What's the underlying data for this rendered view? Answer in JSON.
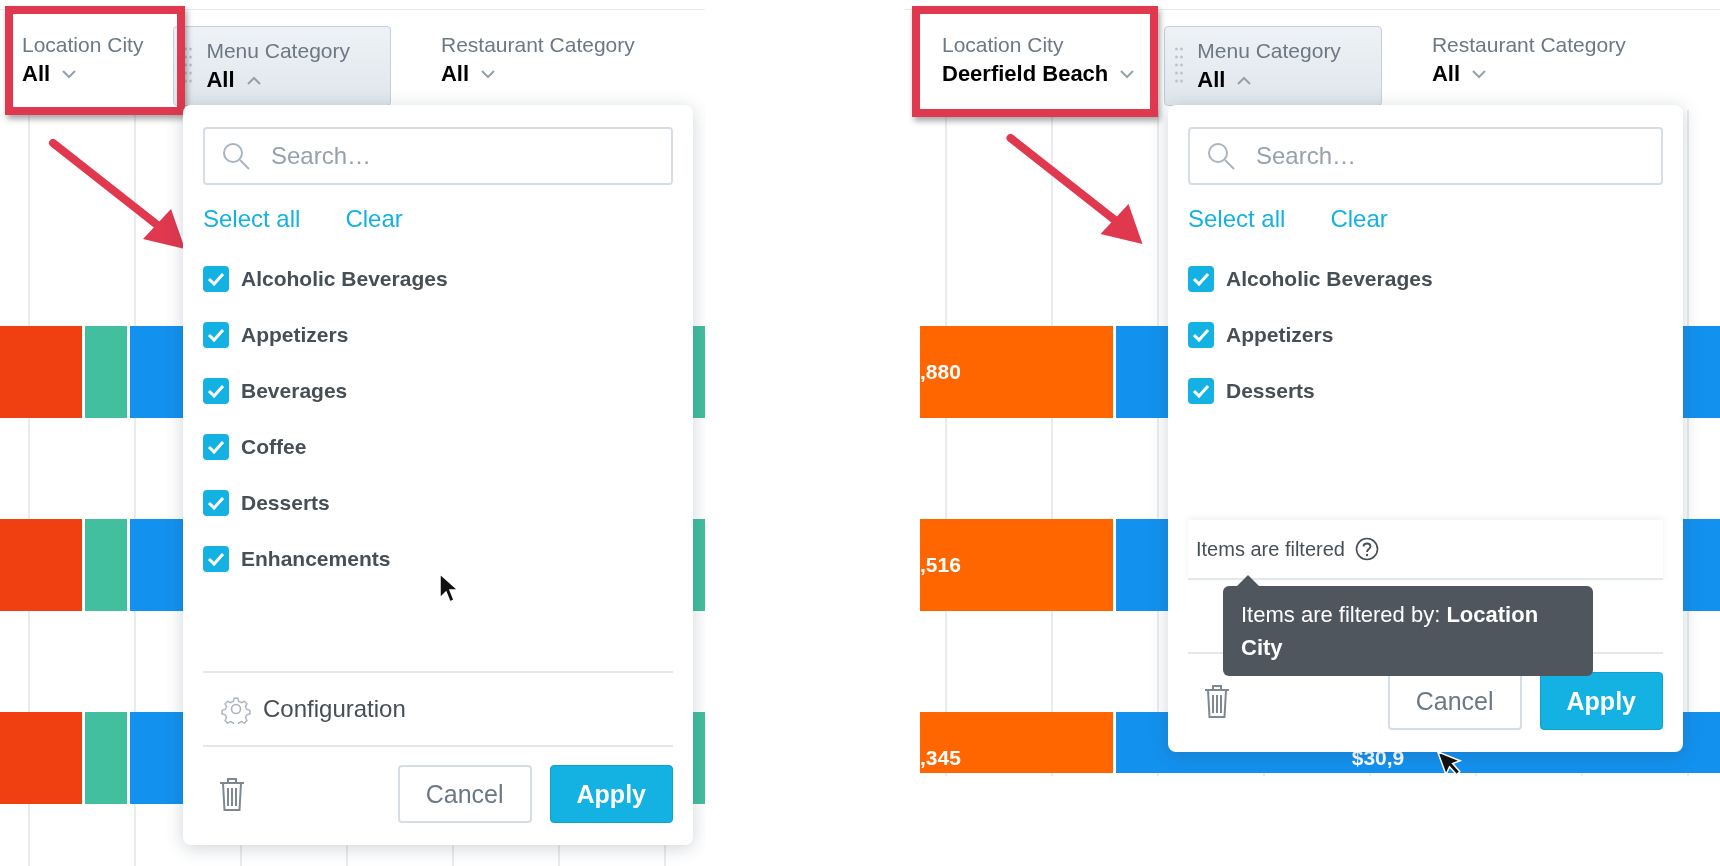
{
  "panels": [
    {
      "filters": [
        {
          "label": "Location City",
          "value": "All",
          "expanded": false,
          "highlighted": true
        },
        {
          "label": "Menu Category",
          "value": "All",
          "expanded": true,
          "highlighted": false
        },
        {
          "label": "Restaurant Category",
          "value": "All",
          "expanded": false,
          "highlighted": false
        }
      ],
      "dropdown": {
        "search": {
          "placeholder": "Search…"
        },
        "select_all": "Select all",
        "clear": "Clear",
        "items": [
          {
            "label": "Alcoholic Beverages",
            "checked": true
          },
          {
            "label": "Appetizers",
            "checked": true
          },
          {
            "label": "Beverages",
            "checked": true
          },
          {
            "label": "Coffee",
            "checked": true
          },
          {
            "label": "Desserts",
            "checked": true
          },
          {
            "label": "Enhancements",
            "checked": true
          }
        ],
        "configuration": "Configuration",
        "cancel": "Cancel",
        "apply": "Apply"
      },
      "chart": {
        "rows": [
          {
            "segments": [
              {
                "color": "#f03f10"
              },
              {
                "color": "#42bf9e"
              },
              {
                "color": "#1391ee"
              },
              {
                "color": "#42bf9e"
              }
            ]
          },
          {
            "segments": [
              {
                "color": "#f03f10"
              },
              {
                "color": "#42bf9e"
              },
              {
                "color": "#1391ee"
              },
              {
                "color": "#42bf9e"
              }
            ]
          },
          {
            "segments": [
              {
                "color": "#f03f10"
              },
              {
                "color": "#42bf9e"
              },
              {
                "color": "#1391ee"
              },
              {
                "color": "#42bf9e"
              }
            ]
          }
        ]
      }
    },
    {
      "filters": [
        {
          "label": "Location City",
          "value": "Deerfield Beach",
          "expanded": false,
          "highlighted": true
        },
        {
          "label": "Menu Category",
          "value": "All",
          "expanded": true,
          "highlighted": false
        },
        {
          "label": "Restaurant Category",
          "value": "All",
          "expanded": false,
          "highlighted": false
        }
      ],
      "dropdown": {
        "search": {
          "placeholder": "Search…"
        },
        "select_all": "Select all",
        "clear": "Clear",
        "items": [
          {
            "label": "Alcoholic Beverages",
            "checked": true
          },
          {
            "label": "Appetizers",
            "checked": true
          },
          {
            "label": "Desserts",
            "checked": true
          }
        ],
        "filtered_notice": "Items are filtered",
        "cancel": "Cancel",
        "apply": "Apply"
      },
      "tooltip": "Items are filtered by: **Location City**",
      "chart": {
        "rows": [
          {
            "segments": [
              {
                "color": "#ff6600",
                "label": ",880"
              },
              {
                "color": "#1391ee"
              }
            ]
          },
          {
            "segments": [
              {
                "color": "#ff6600",
                "label": ",516"
              },
              {
                "color": "#1391ee"
              }
            ]
          },
          {
            "segments": [
              {
                "color": "#ff6600",
                "label": ",345"
              },
              {
                "color": "#1391ee",
                "label": "$30,9"
              }
            ]
          }
        ]
      }
    }
  ]
}
